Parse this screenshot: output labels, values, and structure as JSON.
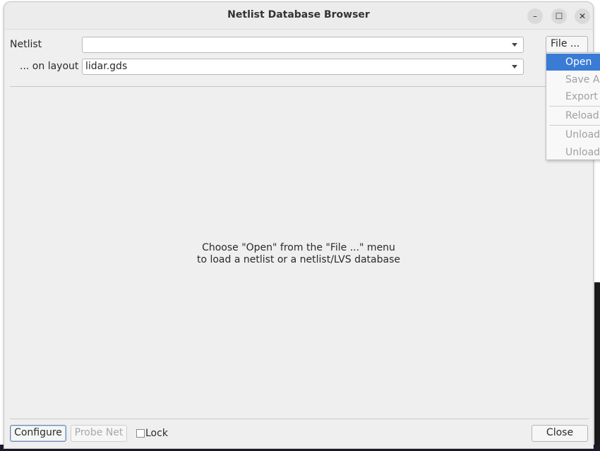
{
  "window": {
    "title": "Netlist Database Browser"
  },
  "window_controls": {
    "minimize": "–",
    "maximize": "☐",
    "close": "✕"
  },
  "form": {
    "netlist_label": "Netlist",
    "netlist_value": "",
    "layout_label": "... on layout",
    "layout_value": "lidar.gds",
    "file_button": "File ..."
  },
  "file_menu": {
    "items": [
      {
        "label": "Open",
        "enabled": true,
        "highlighted": true
      },
      {
        "label": "Save As",
        "enabled": false
      },
      {
        "label": "Export",
        "enabled": false
      },
      {
        "label": "Reload",
        "enabled": false
      },
      {
        "label": "Unload",
        "enabled": false
      },
      {
        "label": "Unload",
        "enabled": false
      }
    ]
  },
  "message": {
    "line1": "Choose \"Open\" from the \"File ...\" menu",
    "line2": "to load a netlist or a netlist/LVS database"
  },
  "footer": {
    "configure": "Configure",
    "probe_net": "Probe Net",
    "lock_label": "Lock",
    "lock_checked": false,
    "close": "Close"
  },
  "colors": {
    "accent": "#3a7bd5",
    "window_bg": "#efefef"
  }
}
